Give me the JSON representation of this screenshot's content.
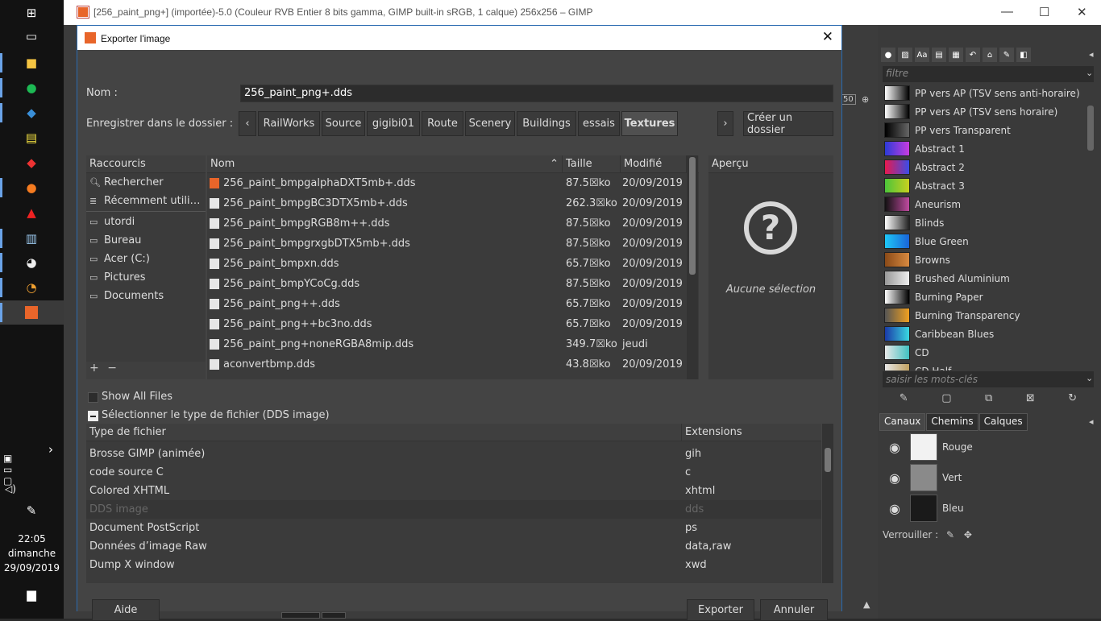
{
  "gimp": {
    "window_title": "[256_paint_png+] (importée)-5.0 (Couleur RVB Entier 8 bits gamma, GIMP built-in sRGB, 1 calque) 256x256 – GIMP",
    "zoom_fragment": "50"
  },
  "taskbar": {
    "time": "22:05",
    "day": "dimanche",
    "date": "29/09/2019"
  },
  "dialog": {
    "title": "Exporter l'image",
    "name_label": "Nom :",
    "name_value": "256_paint_png+.dds",
    "folder_label": "Enregistrer dans le dossier :",
    "path_segments": [
      "RailWorks",
      "Source",
      "gigibi01",
      "Route",
      "Scenery",
      "Buildings",
      "essais",
      "Textures"
    ],
    "create_folder": "Créer un dossier",
    "shortcuts_header": "Raccourcis",
    "shortcuts": [
      {
        "label": "Rechercher",
        "icon": "search-icon"
      },
      {
        "label": "Récemment utili…",
        "icon": "recent-icon"
      },
      {
        "label": "utordi",
        "icon": "folder-icon"
      },
      {
        "label": "Bureau",
        "icon": "folder-icon"
      },
      {
        "label": "Acer (C:)",
        "icon": "drive-icon"
      },
      {
        "label": "Pictures",
        "icon": "folder-icon"
      },
      {
        "label": "Documents",
        "icon": "folder-icon"
      }
    ],
    "columns": {
      "name": "Nom",
      "size": "Taille",
      "modified": "Modifié"
    },
    "files": [
      {
        "name": "256_paint_bmpgalphaDXT5mb+.dds",
        "size": "87.5☒ko",
        "modified": "20/09/2019",
        "icon": "image-icon"
      },
      {
        "name": "256_paint_bmpgBC3DTX5mb+.dds",
        "size": "262.3☒ko",
        "modified": "20/09/2019",
        "icon": "file-icon"
      },
      {
        "name": "256_paint_bmpgRGB8m++.dds",
        "size": "87.5☒ko",
        "modified": "20/09/2019",
        "icon": "file-icon"
      },
      {
        "name": "256_paint_bmpgrxgbDTX5mb+.dds",
        "size": "87.5☒ko",
        "modified": "20/09/2019",
        "icon": "file-icon"
      },
      {
        "name": "256_paint_bmpxn.dds",
        "size": "65.7☒ko",
        "modified": "20/09/2019",
        "icon": "file-icon"
      },
      {
        "name": "256_paint_bmpYCoCg.dds",
        "size": "87.5☒ko",
        "modified": "20/09/2019",
        "icon": "file-icon"
      },
      {
        "name": "256_paint_png++.dds",
        "size": "65.7☒ko",
        "modified": "20/09/2019",
        "icon": "file-icon"
      },
      {
        "name": "256_paint_png++bc3no.dds",
        "size": "65.7☒ko",
        "modified": "20/09/2019",
        "icon": "file-icon"
      },
      {
        "name": "256_paint_png+noneRGBA8mip.dds",
        "size": "349.7☒ko",
        "modified": "jeudi",
        "icon": "file-icon"
      },
      {
        "name": "aconvertbmp.dds",
        "size": "43.8☒ko",
        "modified": "20/09/2019",
        "icon": "file-icon"
      }
    ],
    "preview_header": "Aperçu",
    "no_selection": "Aucune sélection",
    "show_all_files": "Show All Files",
    "select_type": "Sélectionner le type de fichier (DDS image)",
    "type_columns": {
      "type": "Type de fichier",
      "ext": "Extensions"
    },
    "types": [
      {
        "type": "Brosse GIMP (animée)",
        "ext": "gih",
        "disabled": false
      },
      {
        "type": "code source C",
        "ext": "c",
        "disabled": false
      },
      {
        "type": "Colored XHTML",
        "ext": "xhtml",
        "disabled": false
      },
      {
        "type": "DDS image",
        "ext": "dds",
        "disabled": true
      },
      {
        "type": "Document PostScript",
        "ext": "ps",
        "disabled": false
      },
      {
        "type": "Données d’image Raw",
        "ext": "data,raw",
        "disabled": false
      },
      {
        "type": "Dump X window",
        "ext": "xwd",
        "disabled": false
      }
    ],
    "help": "Aide",
    "export": "Exporter",
    "cancel": "Annuler"
  },
  "dock": {
    "filter_placeholder": "filtre",
    "gradients": [
      {
        "name": "PP vers AP (TSV sens anti-horaire)",
        "c1": "#ffffff",
        "c2": "#000000"
      },
      {
        "name": "PP vers AP (TSV sens horaire)",
        "c1": "#ffffff",
        "c2": "#000000"
      },
      {
        "name": "PP vers Transparent",
        "c1": "#000000",
        "c2": "#666666"
      },
      {
        "name": "Abstract 1",
        "c1": "#2b3bd8",
        "c2": "#c83ce0"
      },
      {
        "name": "Abstract 2",
        "c1": "#e8194e",
        "c2": "#3a4de8"
      },
      {
        "name": "Abstract 3",
        "c1": "#4cc43a",
        "c2": "#c8d020"
      },
      {
        "name": "Aneurism",
        "c1": "#111111",
        "c2": "#c04aa0"
      },
      {
        "name": "Blinds",
        "c1": "#ffffff",
        "c2": "#222222"
      },
      {
        "name": "Blue Green",
        "c1": "#1ec8f8",
        "c2": "#1a64d8"
      },
      {
        "name": "Browns",
        "c1": "#8a4a18",
        "c2": "#d88a40"
      },
      {
        "name": "Brushed Aluminium",
        "c1": "#999999",
        "c2": "#eeeeee"
      },
      {
        "name": "Burning Paper",
        "c1": "#ffffff",
        "c2": "#000000"
      },
      {
        "name": "Burning Transparency",
        "c1": "#555555",
        "c2": "#f0a020"
      },
      {
        "name": "Caribbean Blues",
        "c1": "#1a3aa8",
        "c2": "#3ad8e0"
      },
      {
        "name": "CD",
        "c1": "#e8e8e8",
        "c2": "#40c0c0"
      },
      {
        "name": "CD Half",
        "c1": "#e8e8e8",
        "c2": "#c0a060"
      }
    ],
    "keywords_placeholder": "saisir les mots-clés",
    "tabs": [
      "Canaux",
      "Chemins",
      "Calques"
    ],
    "channels": [
      "Rouge",
      "Vert",
      "Bleu"
    ],
    "lock_label": "Verrouiller :"
  }
}
